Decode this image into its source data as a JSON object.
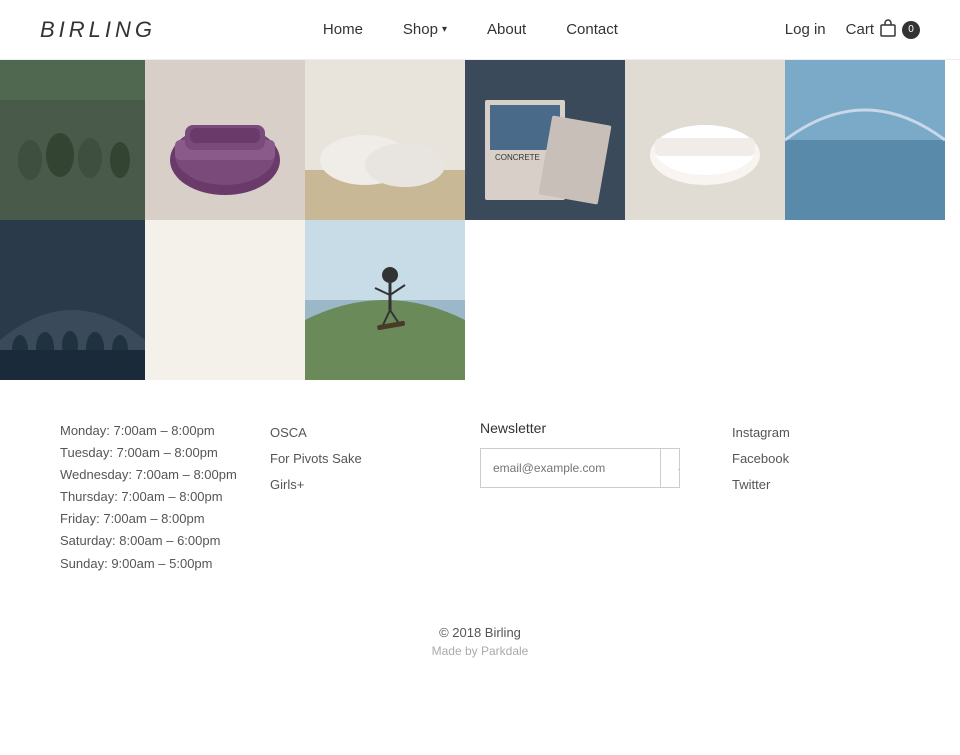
{
  "nav": {
    "logo": "BIRLING",
    "links": [
      {
        "label": "Home",
        "name": "home"
      },
      {
        "label": "Shop",
        "name": "shop",
        "hasDropdown": true
      },
      {
        "label": "About",
        "name": "about"
      },
      {
        "label": "Contact",
        "name": "contact"
      }
    ],
    "login_label": "Log in",
    "cart_label": "Cart",
    "cart_count": "0"
  },
  "photos": [
    {
      "id": "photo-1",
      "alt": "Group photo skate"
    },
    {
      "id": "photo-2",
      "alt": "Purple slip-on shoes"
    },
    {
      "id": "photo-3",
      "alt": "White shoes on wood"
    },
    {
      "id": "photo-4",
      "alt": "Skate magazine on boards"
    },
    {
      "id": "photo-5",
      "alt": "White shoes"
    },
    {
      "id": "photo-6",
      "alt": "Skate ramp blue"
    },
    {
      "id": "photo-7",
      "alt": "Indoor skate ramp crowd"
    },
    {
      "id": "photo-8",
      "alt": "Blank panel"
    },
    {
      "id": "photo-9",
      "alt": "Skater doing trick"
    }
  ],
  "footer": {
    "hours": [
      {
        "day_time": "Monday: 7:00am – 8:00pm"
      },
      {
        "day_time": "Tuesday: 7:00am – 8:00pm"
      },
      {
        "day_time": "Wednesday: 7:00am – 8:00pm"
      },
      {
        "day_time": "Thursday: 7:00am – 8:00pm"
      },
      {
        "day_time": "Friday: 7:00am – 8:00pm"
      },
      {
        "day_time": "Saturday: 8:00am – 6:00pm"
      },
      {
        "day_time": "Sunday: 9:00am – 5:00pm"
      }
    ],
    "links": [
      {
        "label": "OSCA",
        "name": "osca-link"
      },
      {
        "label": "For Pivots Sake",
        "name": "for-pivots-sake-link"
      },
      {
        "label": "Girls+",
        "name": "girls-plus-link"
      }
    ],
    "newsletter": {
      "title": "Newsletter",
      "placeholder": "email@example.com",
      "button_icon": "→"
    },
    "social": [
      {
        "label": "Instagram",
        "name": "instagram-link"
      },
      {
        "label": "Facebook",
        "name": "facebook-link"
      },
      {
        "label": "Twitter",
        "name": "twitter-link"
      }
    ],
    "copyright": "© 2018 Birling",
    "made_by": "Made by Parkdale"
  }
}
